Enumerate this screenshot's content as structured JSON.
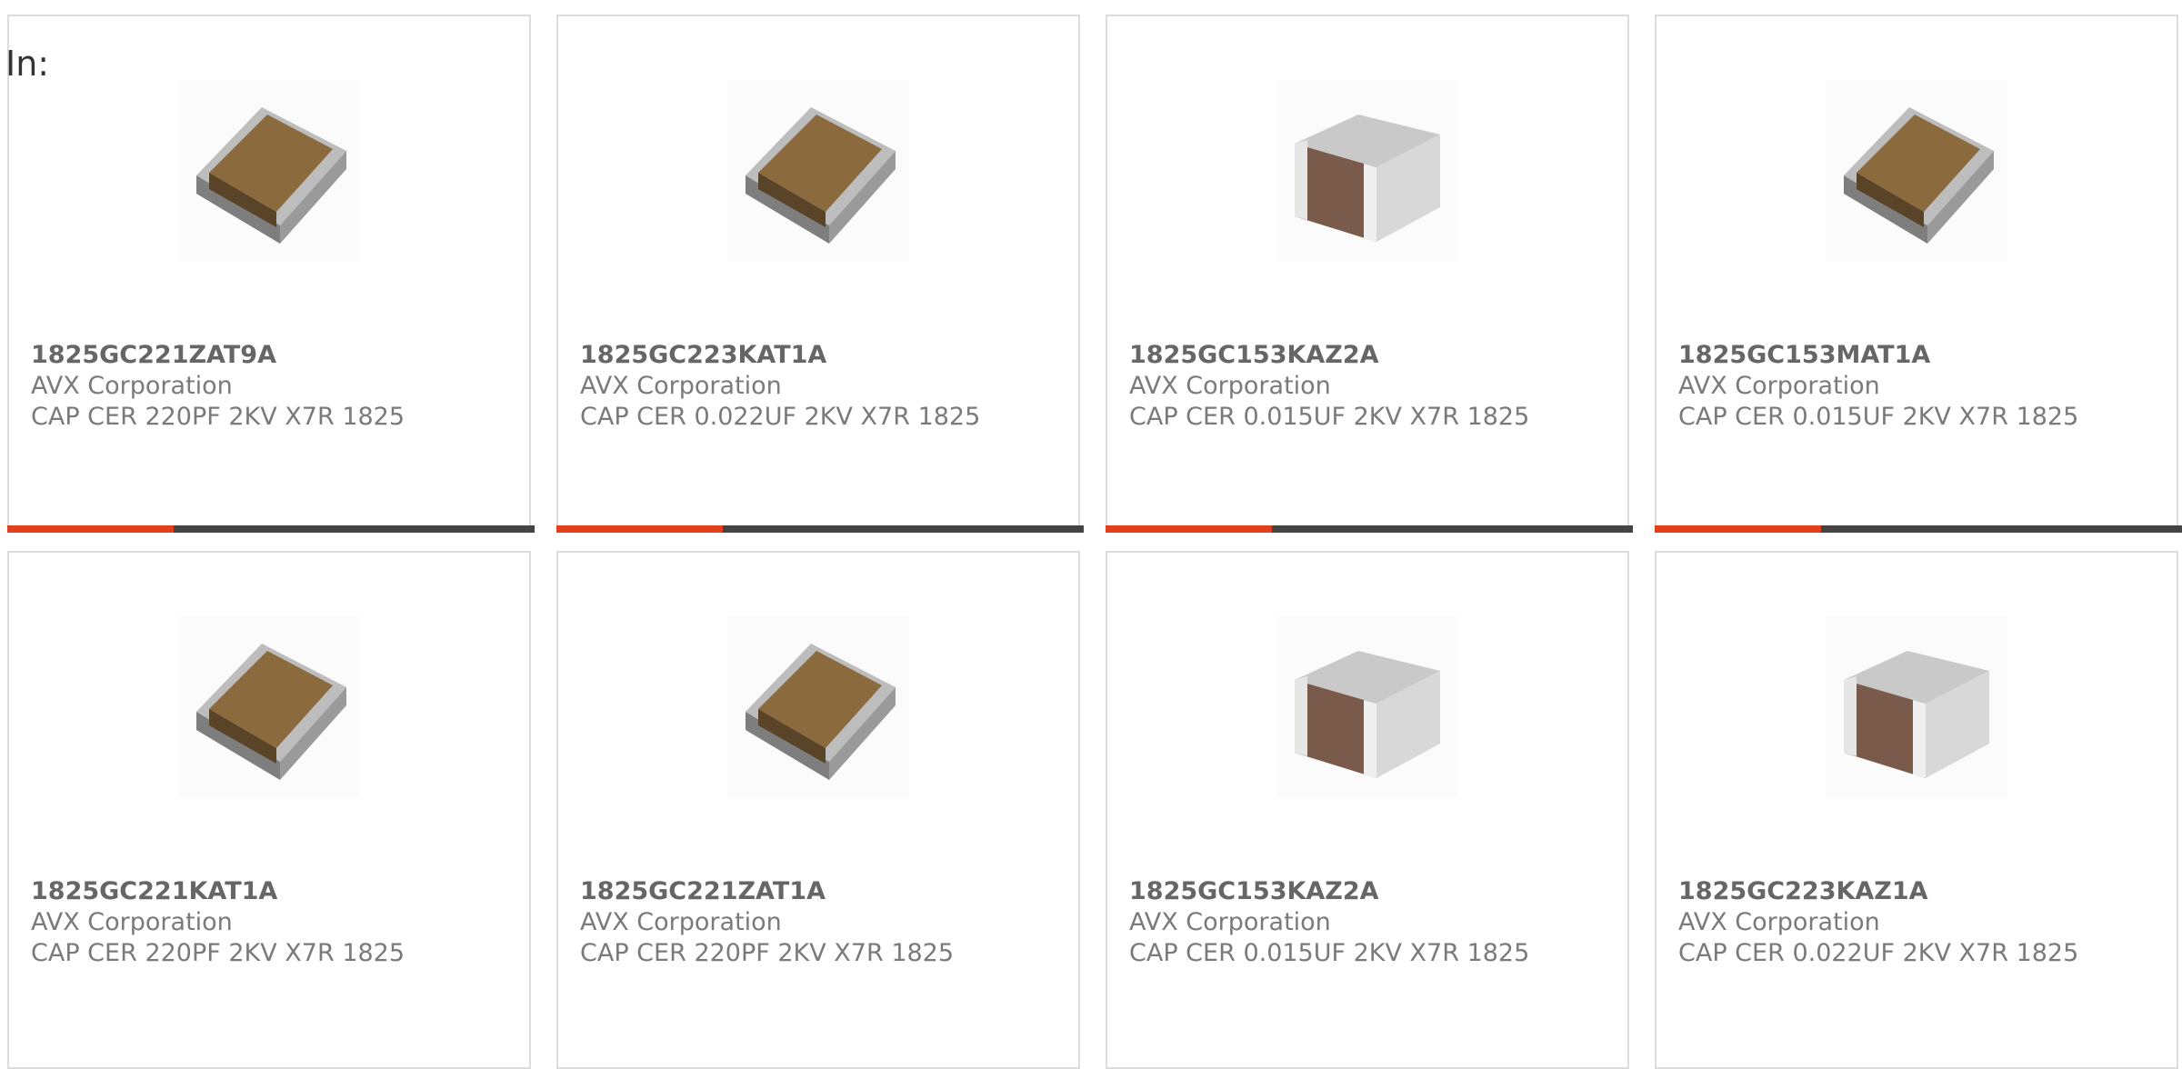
{
  "header": {
    "in_label": "In:"
  },
  "colors": {
    "accent": "#e2401c",
    "bar_dark": "#444444",
    "border": "#dcdcdc"
  },
  "progress_fraction": 0.315,
  "products": [
    {
      "part_number": "1825GC221ZAT9A",
      "manufacturer": "AVX Corporation",
      "description": "CAP CER 220PF 2KV X7R 1825",
      "image_icon": "flat-capacitor-chip-icon"
    },
    {
      "part_number": "1825GC223KAT1A",
      "manufacturer": "AVX Corporation",
      "description": "CAP CER 0.022UF 2KV X7R 1825",
      "image_icon": "flat-capacitor-chip-icon"
    },
    {
      "part_number": "1825GC153KAZ2A",
      "manufacturer": "AVX Corporation",
      "description": "CAP CER 0.015UF 2KV X7R 1825",
      "image_icon": "box-capacitor-chip-icon"
    },
    {
      "part_number": "1825GC153MAT1A",
      "manufacturer": "AVX Corporation",
      "description": "CAP CER 0.015UF 2KV X7R 1825",
      "image_icon": "flat-capacitor-chip-icon"
    },
    {
      "part_number": "1825GC221KAT1A",
      "manufacturer": "AVX Corporation",
      "description": "CAP CER 220PF 2KV X7R 1825",
      "image_icon": "flat-capacitor-chip-icon"
    },
    {
      "part_number": "1825GC221ZAT1A",
      "manufacturer": "AVX Corporation",
      "description": "CAP CER 220PF 2KV X7R 1825",
      "image_icon": "flat-capacitor-chip-icon"
    },
    {
      "part_number": "1825GC153KAZ2A",
      "manufacturer": "AVX Corporation",
      "description": "CAP CER 0.015UF 2KV X7R 1825",
      "image_icon": "box-capacitor-chip-icon"
    },
    {
      "part_number": "1825GC223KAZ1A",
      "manufacturer": "AVX Corporation",
      "description": "CAP CER 0.022UF 2KV X7R 1825",
      "image_icon": "box-capacitor-chip-icon"
    }
  ]
}
